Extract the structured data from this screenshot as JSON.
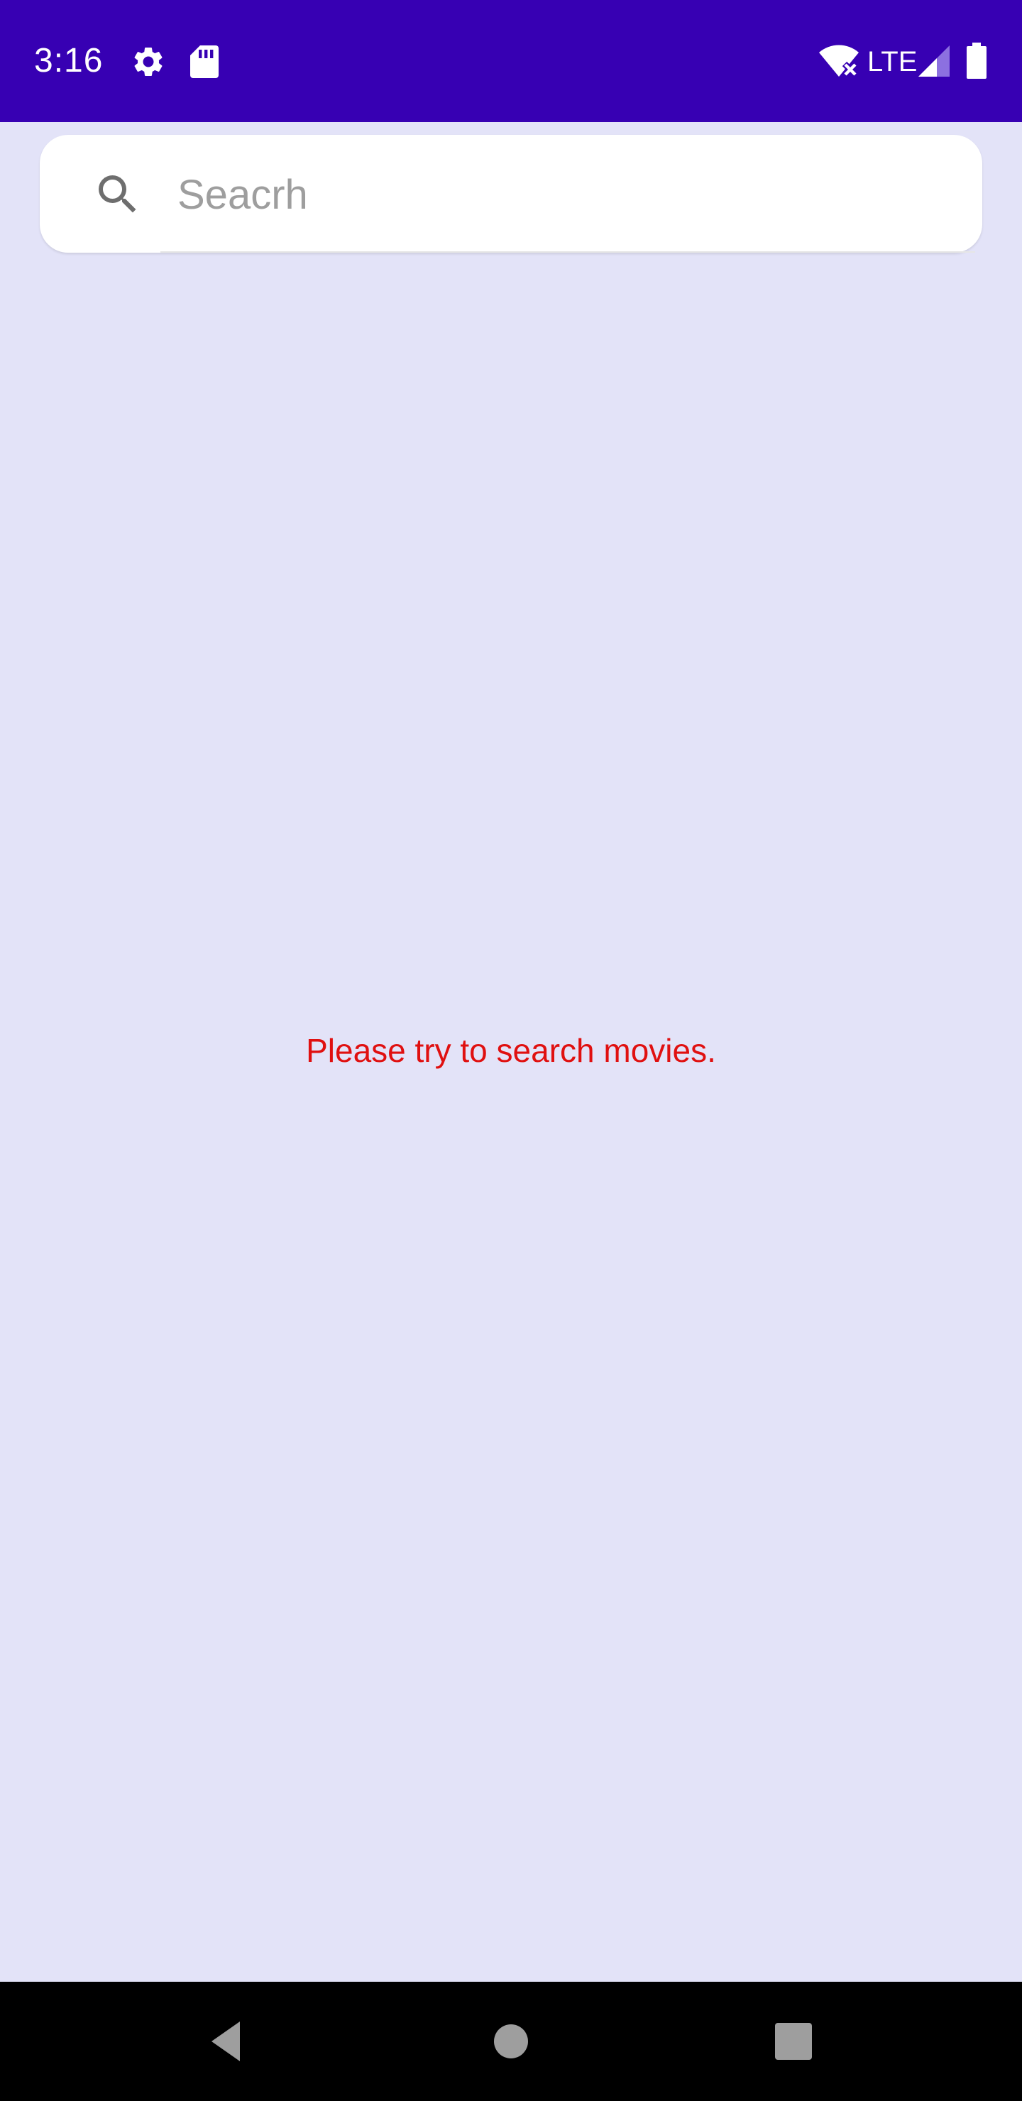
{
  "status_bar": {
    "time": "3:16",
    "network": "LTE",
    "background_color": "#3700B3",
    "icons": [
      "gear-icon",
      "sd-card-icon",
      "wifi-off-icon",
      "signal-icon",
      "battery-icon"
    ]
  },
  "search": {
    "placeholder": "Seacrh",
    "value": "",
    "icon": "search-icon"
  },
  "empty_state": {
    "message": "Please try to search movies.",
    "color": "#E01010"
  },
  "nav_bar": {
    "buttons": [
      "back-icon",
      "home-icon",
      "recents-icon"
    ]
  },
  "colors": {
    "background": "#E3E3F8",
    "accent": "#3700B3"
  }
}
